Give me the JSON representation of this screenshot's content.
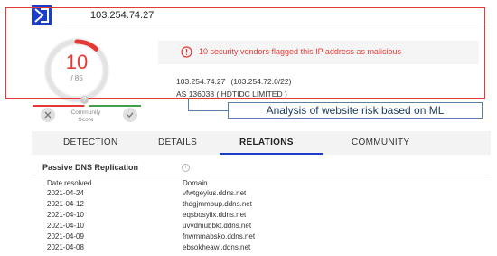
{
  "header": {
    "ip_title": "103.254.74.27"
  },
  "score": {
    "detections": "10",
    "total": "/ 85",
    "ratio": 0.1176
  },
  "alert": {
    "message": "10 security vendors flagged this IP address as malicious"
  },
  "ip_info": {
    "ip": "103.254.74.27",
    "range": "(103.254.72.0/22)",
    "asn": "AS 136038 ( HDTIDC LIMITED )"
  },
  "community": {
    "label_line1": "Community",
    "label_line2": "Score",
    "question": "?"
  },
  "annotation": {
    "text": "Analysis of website risk based on ML"
  },
  "tabs": [
    {
      "label": "DETECTION"
    },
    {
      "label": "DETAILS"
    },
    {
      "label": "RELATIONS"
    },
    {
      "label": "COMMUNITY"
    }
  ],
  "passive_dns": {
    "title": "Passive DNS Replication",
    "info": "i",
    "columns": {
      "date": "Date resolved",
      "domain": "Domain"
    },
    "rows": [
      {
        "date": "2021-04-24",
        "domain": "vfwtgeyius.ddns.net"
      },
      {
        "date": "2021-04-12",
        "domain": "thdgjmmbup.ddns.net"
      },
      {
        "date": "2021-04-10",
        "domain": "eqsbosyiix.ddns.net"
      },
      {
        "date": "2021-04-10",
        "domain": "uvvdmubbkt.ddns.net"
      },
      {
        "date": "2021-04-09",
        "domain": "fnwmmabsko.ddns.net"
      },
      {
        "date": "2021-04-08",
        "domain": "ebsokheawl.ddns.net"
      }
    ]
  },
  "colors": {
    "brand": "#1a3ec9",
    "danger": "#e53935",
    "positive": "#43a047",
    "annotation": "#1c3a5e"
  }
}
